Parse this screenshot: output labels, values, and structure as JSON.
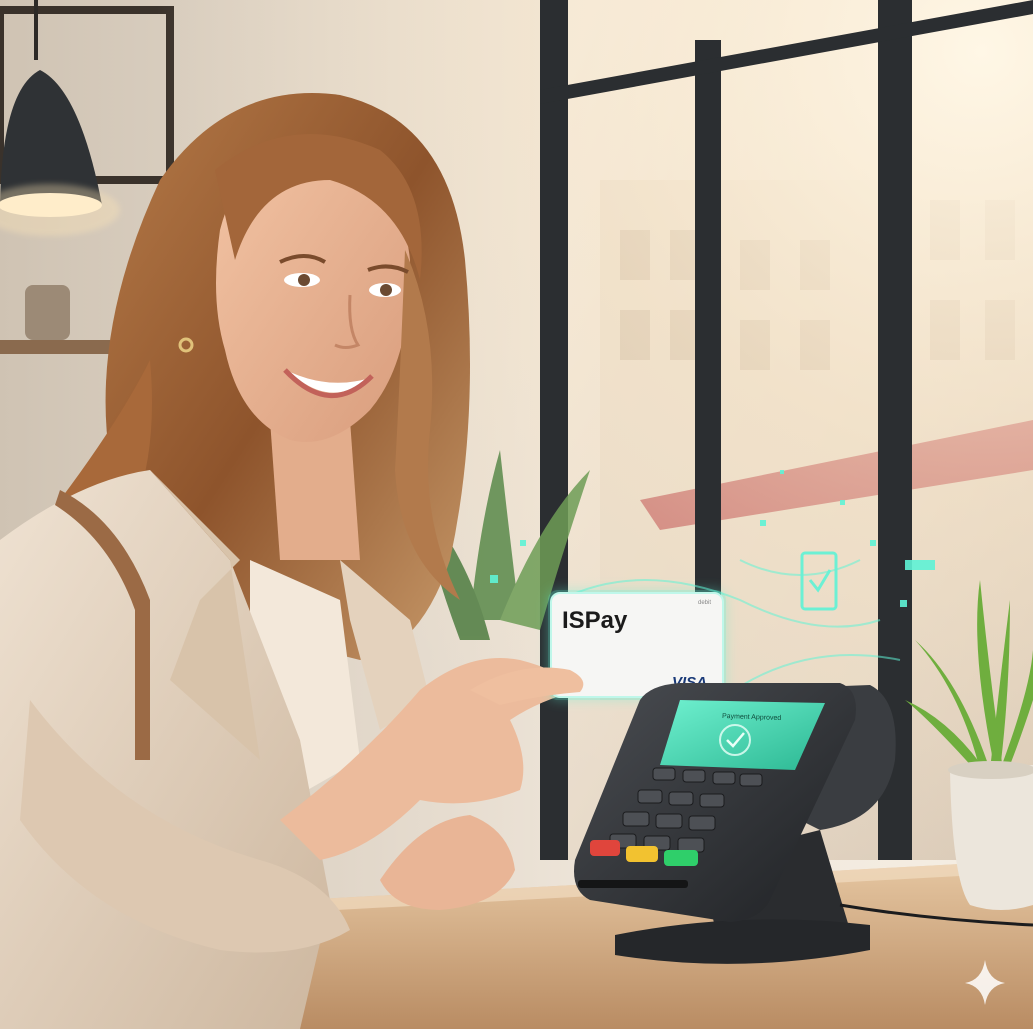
{
  "card": {
    "brand": "ISPay",
    "network": "VISA",
    "small_text": "debit"
  },
  "terminal": {
    "screen_status": "Payment Approved",
    "device_label": "terminal"
  },
  "colors": {
    "hologram": "#5ff3d6",
    "screen": "#43d7b5",
    "key_red": "#e0453c",
    "key_yellow": "#f2c230",
    "key_green": "#2fcf6a",
    "wall": "#efe7dc",
    "table": "#d9b48c",
    "blazer": "#e8d8c4",
    "hair": "#9a5e34"
  },
  "icons": {
    "confirm": "check-icon",
    "corner": "sparkle-icon"
  }
}
